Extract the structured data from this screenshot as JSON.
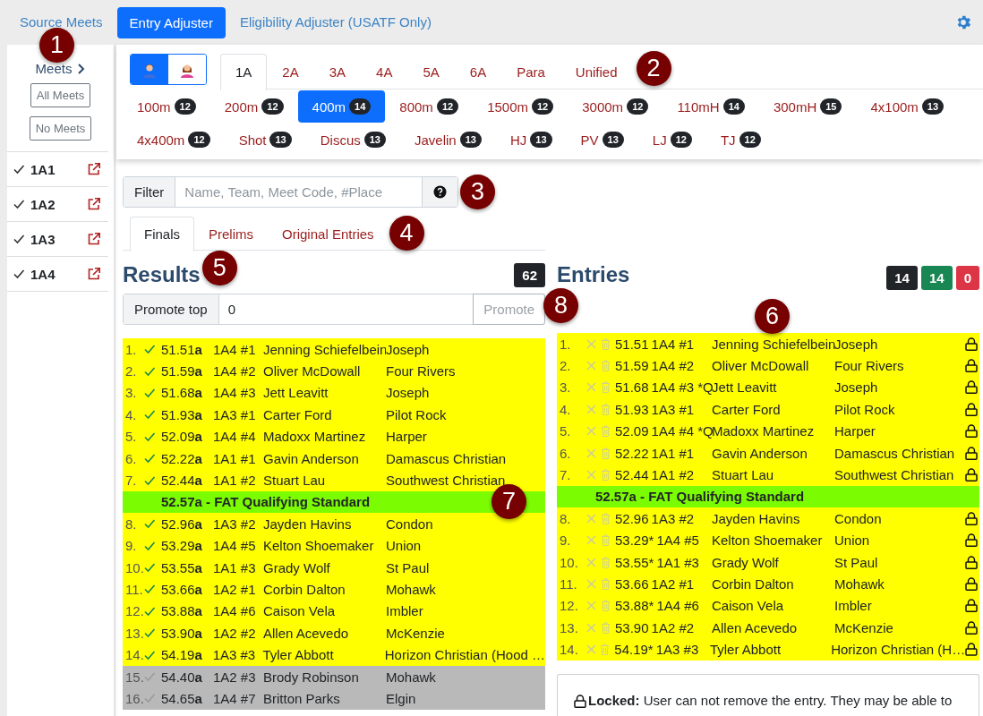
{
  "nav": {
    "links": [
      {
        "label": "Source Meets",
        "selected": false
      },
      {
        "label": "Entry Adjuster",
        "selected": true
      },
      {
        "label": "Eligibility Adjuster (USATF Only)",
        "selected": false
      }
    ]
  },
  "sidebar": {
    "header": {
      "label": "Meets",
      "callout": "1"
    },
    "buttons": [
      "All Meets",
      "No Meets"
    ],
    "meets": [
      {
        "label": "1A1",
        "checked": true
      },
      {
        "label": "1A2",
        "checked": true
      },
      {
        "label": "1A3",
        "checked": true
      },
      {
        "label": "1A4",
        "checked": true
      }
    ]
  },
  "genders": [
    {
      "kind": "male",
      "selected": true
    },
    {
      "kind": "female",
      "selected": false
    }
  ],
  "classes": {
    "callout": "2",
    "tabs": [
      {
        "label": "1A",
        "selected": true
      },
      {
        "label": "2A",
        "selected": false
      },
      {
        "label": "3A",
        "selected": false
      },
      {
        "label": "4A",
        "selected": false
      },
      {
        "label": "5A",
        "selected": false
      },
      {
        "label": "6A",
        "selected": false
      },
      {
        "label": "Para",
        "selected": false
      },
      {
        "label": "Unified",
        "selected": false
      }
    ]
  },
  "events": [
    {
      "label": "100m",
      "count": "12",
      "selected": false
    },
    {
      "label": "200m",
      "count": "12",
      "selected": false
    },
    {
      "label": "400m",
      "count": "14",
      "selected": true
    },
    {
      "label": "800m",
      "count": "12",
      "selected": false
    },
    {
      "label": "1500m",
      "count": "12",
      "selected": false
    },
    {
      "label": "3000m",
      "count": "12",
      "selected": false
    },
    {
      "label": "110mH",
      "count": "14",
      "selected": false
    },
    {
      "label": "300mH",
      "count": "15",
      "selected": false
    },
    {
      "label": "4x100m",
      "count": "13",
      "selected": false
    },
    {
      "label": "4x400m",
      "count": "12",
      "selected": false
    },
    {
      "label": "Shot",
      "count": "13",
      "selected": false
    },
    {
      "label": "Discus",
      "count": "13",
      "selected": false
    },
    {
      "label": "Javelin",
      "count": "13",
      "selected": false
    },
    {
      "label": "HJ",
      "count": "13",
      "selected": false
    },
    {
      "label": "PV",
      "count": "13",
      "selected": false
    },
    {
      "label": "LJ",
      "count": "12",
      "selected": false
    },
    {
      "label": "TJ",
      "count": "12",
      "selected": false
    }
  ],
  "filter": {
    "label": "Filter",
    "placeholder": "Name, Team, Meet Code, #Place",
    "callout": "3"
  },
  "result_tabs": {
    "callout": "4",
    "tabs": [
      {
        "label": "Finals",
        "selected": true
      },
      {
        "label": "Prelims",
        "selected": false
      },
      {
        "label": "Original Entries",
        "selected": false
      }
    ]
  },
  "results": {
    "title": "Results",
    "callout": "5",
    "count": "62",
    "promote": {
      "label": "Promote top",
      "value": "0",
      "button": "Promote",
      "disabled": true,
      "callout": "8"
    },
    "rows": [
      {
        "kind": "athlete",
        "place": "1.",
        "qualified": true,
        "time": "51.51**a**",
        "heat": "1A4 #1",
        "name": "Jenning Schiefelbein",
        "team": "Joseph"
      },
      {
        "kind": "athlete",
        "place": "2.",
        "qualified": true,
        "time": "51.59**a**",
        "heat": "1A4 #2",
        "name": "Oliver McDowall",
        "team": "Four Rivers"
      },
      {
        "kind": "athlete",
        "place": "3.",
        "qualified": true,
        "time": "51.68**a**",
        "heat": "1A4 #3",
        "name": "Jett Leavitt",
        "team": "Joseph"
      },
      {
        "kind": "athlete",
        "place": "4.",
        "qualified": true,
        "time": "51.93**a**",
        "heat": "1A3 #1",
        "name": "Carter Ford",
        "team": "Pilot Rock"
      },
      {
        "kind": "athlete",
        "place": "5.",
        "qualified": true,
        "time": "52.09**a**",
        "heat": "1A4 #4",
        "name": "Madoxx Martinez",
        "team": "Harper"
      },
      {
        "kind": "athlete",
        "place": "6.",
        "qualified": true,
        "time": "52.22**a**",
        "heat": "1A1 #1",
        "name": "Gavin Anderson",
        "team": "Damascus Christian"
      },
      {
        "kind": "athlete",
        "place": "7.",
        "qualified": true,
        "time": "52.44**a**",
        "heat": "1A1 #2",
        "name": "Stuart Lau",
        "team": "Southwest Christian"
      },
      {
        "kind": "standard",
        "label": "52.57a - FAT Qualifying Standard",
        "callout": "7"
      },
      {
        "kind": "athlete",
        "place": "8.",
        "qualified": true,
        "time": "52.96**a**",
        "heat": "1A3 #2",
        "name": "Jayden Havins",
        "team": "Condon"
      },
      {
        "kind": "athlete",
        "place": "9.",
        "qualified": true,
        "time": "53.29**a**",
        "heat": "1A4 #5",
        "name": "Kelton Shoemaker",
        "team": "Union"
      },
      {
        "kind": "athlete",
        "place": "10.",
        "qualified": true,
        "time": "53.55**a**",
        "heat": "1A1 #3",
        "name": "Grady Wolf",
        "team": "St Paul"
      },
      {
        "kind": "athlete",
        "place": "11.",
        "qualified": true,
        "time": "53.66**a**",
        "heat": "1A2 #1",
        "name": "Corbin Dalton",
        "team": "Mohawk"
      },
      {
        "kind": "athlete",
        "place": "12.",
        "qualified": true,
        "time": "53.88**a**",
        "heat": "1A4 #6",
        "name": "Caison Vela",
        "team": "Imbler"
      },
      {
        "kind": "athlete",
        "place": "13.",
        "qualified": true,
        "time": "53.90**a**",
        "heat": "1A2 #2",
        "name": "Allen Acevedo",
        "team": "McKenzie"
      },
      {
        "kind": "athlete",
        "place": "14.",
        "qualified": true,
        "time": "54.19**a**",
        "heat": "1A3 #3",
        "name": "Tyler Abbott",
        "team": "Horizon Christian (Hood …"
      },
      {
        "kind": "athlete",
        "place": "15.",
        "qualified": false,
        "time": "54.40**a**",
        "heat": "1A2 #3",
        "name": "Brody Robinson",
        "team": "Mohawk"
      },
      {
        "kind": "athlete",
        "place": "16.",
        "qualified": false,
        "time": "54.65**a**",
        "heat": "1A4 #7",
        "name": "Britton Parks",
        "team": "Elgin"
      }
    ]
  },
  "entries": {
    "title": "Entries",
    "callout": "6",
    "counts": [
      {
        "value": "14",
        "color": "#212529"
      },
      {
        "value": "14",
        "color": "#198754"
      },
      {
        "value": "0",
        "color": "#dc3545"
      }
    ],
    "rows": [
      {
        "kind": "athlete",
        "place": "1.",
        "time": "51.51",
        "heat": "1A4 #1",
        "name": "Jenning Schiefelbein",
        "team": "Joseph",
        "locked": true
      },
      {
        "kind": "athlete",
        "place": "2.",
        "time": "51.59",
        "heat": "1A4 #2",
        "name": "Oliver McDowall",
        "team": "Four Rivers",
        "locked": true
      },
      {
        "kind": "athlete",
        "place": "3.",
        "time": "51.68",
        "heat": "1A4 #3 *Q",
        "name": "Jett Leavitt",
        "team": "Joseph",
        "locked": true
      },
      {
        "kind": "athlete",
        "place": "4.",
        "time": "51.93",
        "heat": "1A3 #1",
        "name": "Carter Ford",
        "team": "Pilot Rock",
        "locked": true
      },
      {
        "kind": "athlete",
        "place": "5.",
        "time": "52.09",
        "heat": "1A4 #4 *Q",
        "name": "Madoxx Martinez",
        "team": "Harper",
        "locked": true
      },
      {
        "kind": "athlete",
        "place": "6.",
        "time": "52.22",
        "heat": "1A1 #1",
        "name": "Gavin Anderson",
        "team": "Damascus Christian",
        "locked": true
      },
      {
        "kind": "athlete",
        "place": "7.",
        "time": "52.44",
        "heat": "1A1 #2",
        "name": "Stuart Lau",
        "team": "Southwest Christian",
        "locked": true
      },
      {
        "kind": "standard",
        "label": "52.57a - FAT Qualifying Standard"
      },
      {
        "kind": "athlete",
        "place": "8.",
        "time": "52.96",
        "heat": "1A3 #2",
        "name": "Jayden Havins",
        "team": "Condon",
        "locked": true
      },
      {
        "kind": "athlete",
        "place": "9.",
        "time": "53.29*",
        "heat": "1A4 #5",
        "name": "Kelton Shoemaker",
        "team": "Union",
        "locked": true
      },
      {
        "kind": "athlete",
        "place": "10.",
        "time": "53.55*",
        "heat": "1A1 #3",
        "name": "Grady Wolf",
        "team": "St Paul",
        "locked": true
      },
      {
        "kind": "athlete",
        "place": "11.",
        "time": "53.66",
        "heat": "1A2 #1",
        "name": "Corbin Dalton",
        "team": "Mohawk",
        "locked": true
      },
      {
        "kind": "athlete",
        "place": "12.",
        "time": "53.88*",
        "heat": "1A4 #6",
        "name": "Caison Vela",
        "team": "Imbler",
        "locked": true
      },
      {
        "kind": "athlete",
        "place": "13.",
        "time": "53.90",
        "heat": "1A2 #2",
        "name": "Allen Acevedo",
        "team": "McKenzie",
        "locked": true
      },
      {
        "kind": "athlete",
        "place": "14.",
        "time": "54.19*",
        "heat": "1A3 #3",
        "name": "Tyler Abbott",
        "team": "Horizon Christian (H…",
        "locked": true
      }
    ],
    "note": "**Locked:** User can not remove the entry. They may be able to"
  }
}
